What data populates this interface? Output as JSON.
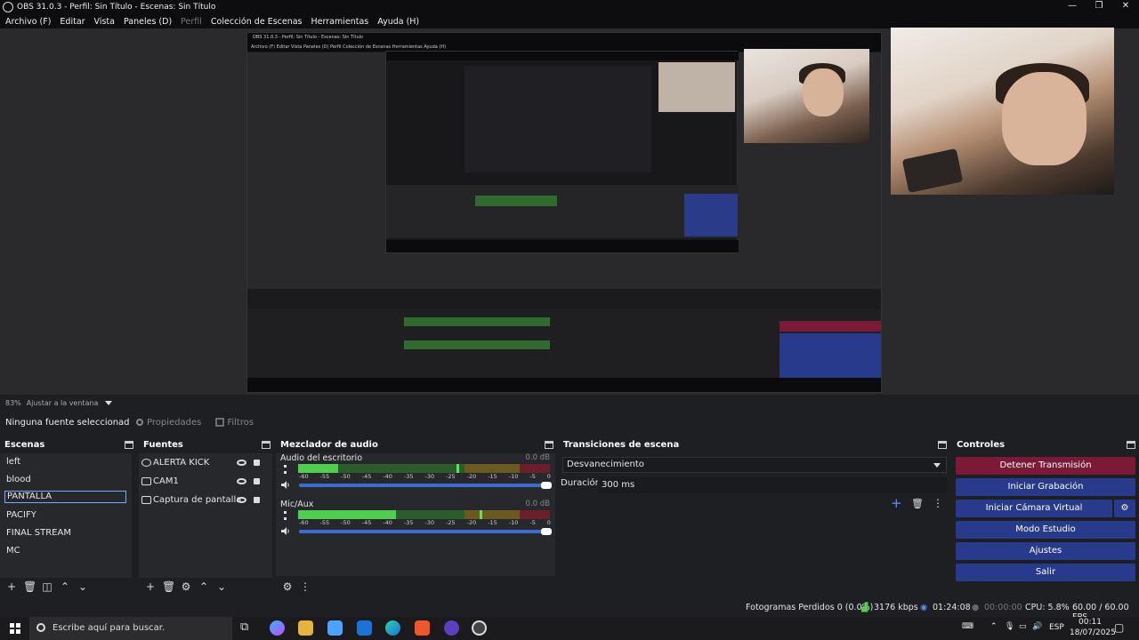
{
  "window": {
    "title": "OBS 31.0.3 - Perfil: Sin Título - Escenas: Sin Título",
    "minimize": "—",
    "maximize": "❐",
    "close": "✕"
  },
  "menu": [
    "Archivo (F)",
    "Editar",
    "Vista",
    "Paneles (D)",
    "Perfil",
    "Colección de Escenas",
    "Herramientas",
    "Ayuda (H)"
  ],
  "nested": {
    "title": "OBS 31.0.3 - Perfil: Sin Título - Escenas: Sin Título",
    "menu": "Archivo (F)   Editar   Vista   Paneles (D)   Perfil   Colección de Escenas   Herramientas   Ayuda (H)"
  },
  "preview": {
    "zoom": "83%",
    "fit": "Ajustar a la ventana"
  },
  "source_toolbar": {
    "no_selection": "Ninguna fuente seleccionada",
    "properties": "Propiedades",
    "filters": "Filtros"
  },
  "scenes": {
    "title": "Escenas",
    "items": [
      "left",
      "blood",
      "PANTALLA",
      "PACIFY",
      "FINAL STREAM",
      "MC"
    ],
    "selected": "PANTALLA"
  },
  "sources": {
    "title": "Fuentes",
    "items": [
      "ALERTA KICK",
      "CAM1",
      "Captura de pantalla"
    ]
  },
  "mixer": {
    "title": "Mezclador de audio",
    "channels": [
      {
        "name": "Audio del escritorio",
        "db": "0.0 dB",
        "level": 0.16,
        "peak": 0.63
      },
      {
        "name": "Mic/Aux",
        "db": "0.0 dB",
        "level": 0.39,
        "peak": 0.72
      }
    ],
    "ticks": [
      "-60",
      "-55",
      "-50",
      "-45",
      "-40",
      "-35",
      "-30",
      "-25",
      "-20",
      "-15",
      "-10",
      "-5",
      "0"
    ]
  },
  "transitions": {
    "title": "Transiciones de escena",
    "selected": "Desvanecimiento",
    "duration_label": "Duración",
    "duration_value": "300 ms"
  },
  "controls": {
    "title": "Controles",
    "buttons": [
      "Detener Transmisión",
      "Iniciar Grabación",
      "Iniciar Cámara Virtual",
      "Modo Estudio",
      "Ajustes",
      "Salir"
    ]
  },
  "status": {
    "frames": "Fotogramas Perdidos 0 (0.0%)",
    "bitrate": "3176 kbps",
    "stream_time": "01:24:08",
    "rec_time": "00:00:00",
    "cpu": "CPU: 5.8%",
    "fps": "60.00 / 60.00 FPS"
  },
  "taskbar": {
    "search_placeholder": "Escribe aquí para buscar.",
    "lang": "ESP",
    "time": "00:11",
    "date": "18/07/2025"
  },
  "colors": {
    "stop_button": "#7b1a37",
    "control_button": "#283a8c",
    "meter_green": "#4fce4f",
    "slider_blue": "#3d6bd6"
  }
}
